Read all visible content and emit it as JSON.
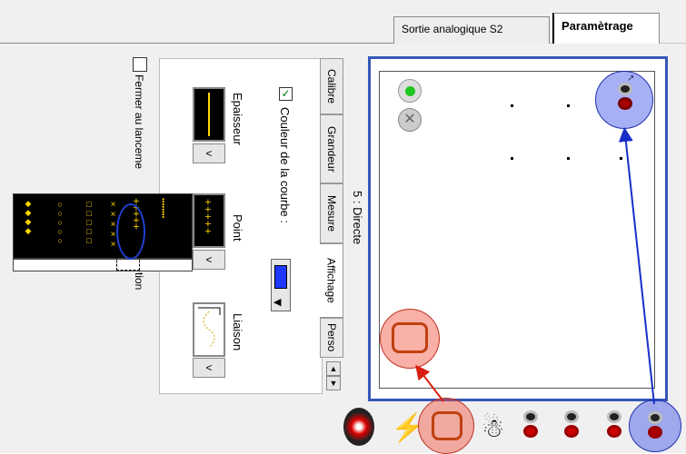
{
  "tabs": [
    {
      "label": "Sortie analogique S2",
      "active": false
    },
    {
      "label": "Paramètrage",
      "active": true
    }
  ],
  "checkbox_fermer": {
    "label": "Fermer au lancement de l'acquisition",
    "label_visible_start": "Fermer au lanceme",
    "label_visible_end": "tion",
    "checked": false
  },
  "panel": {
    "title": "5 : Directe",
    "color_checkbox_label": "Couleur de la courbe :",
    "color_checked": true,
    "curve_color": "#1e38ff",
    "epaisseur_label": "Epaisseur",
    "point_label": "Point",
    "liaison_label": "Liaison",
    "point_symbol_selected": "+",
    "point_options": [
      "◆",
      "○",
      "□",
      "×",
      "+",
      "•"
    ]
  },
  "vertical_tabs": [
    {
      "label": "Calibre"
    },
    {
      "label": "Grandeur"
    },
    {
      "label": "Mesure"
    },
    {
      "label": "Affichage",
      "active": true
    },
    {
      "label": "Perso"
    }
  ],
  "icons": [
    "green-light-icon",
    "close-x-icon",
    "terminal-pair-icon",
    "scope-icon",
    "meter-icon",
    "wand-icon",
    "ghost-icon"
  ],
  "colors": {
    "frame": "#3557b7",
    "annotation_blue": "#3c50e6",
    "annotation_red": "#f0503c"
  }
}
